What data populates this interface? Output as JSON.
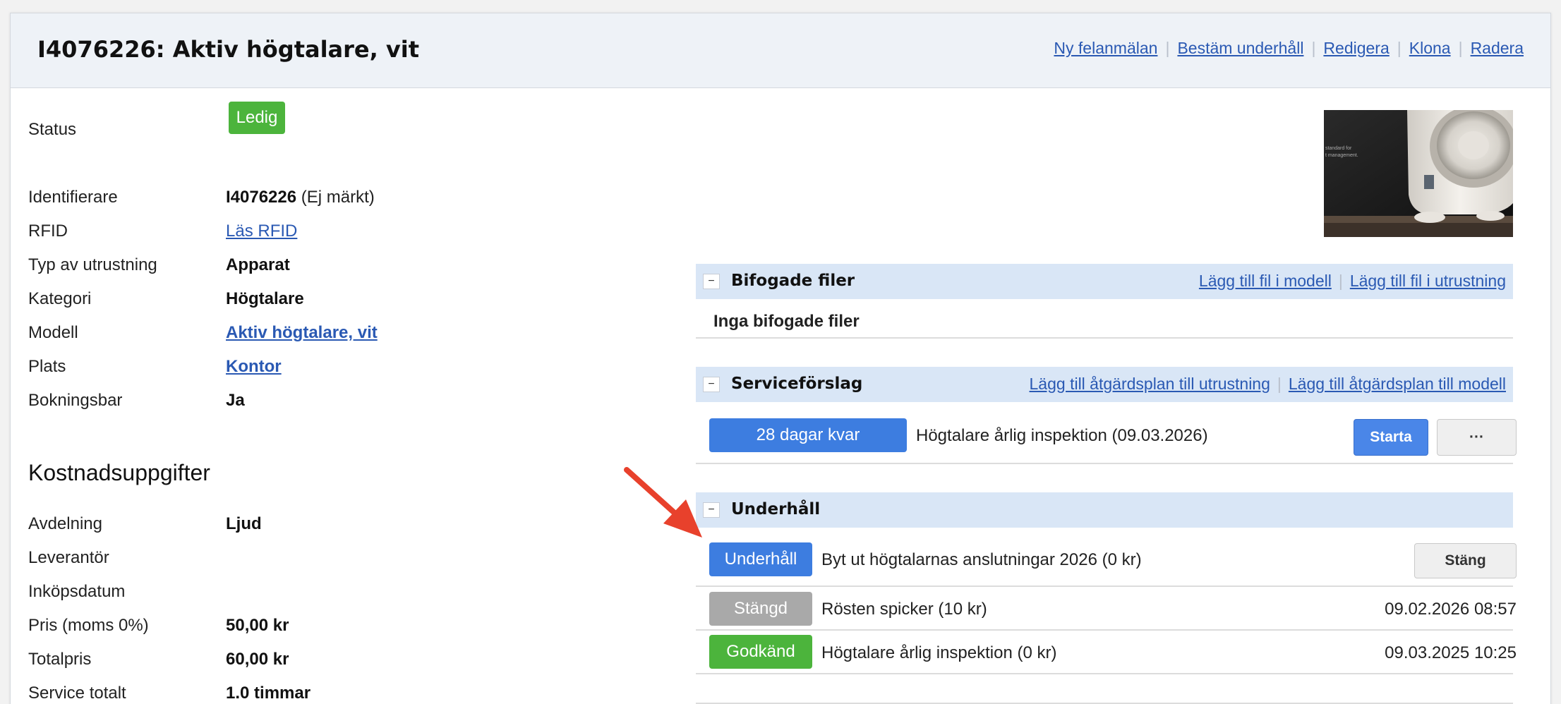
{
  "header": {
    "title": "I4076226: Aktiv högtalare, vit",
    "actions": [
      "Ny felanmälan",
      "Bestäm underhåll",
      "Redigera",
      "Klona",
      "Radera"
    ]
  },
  "status": {
    "label": "Status",
    "value": "Ledig",
    "color": "#4cb43c"
  },
  "details": {
    "identifier_label": "Identifierare",
    "identifier_value": "I4076226",
    "identifier_note": "(Ej märkt)",
    "rfid_label": "RFID",
    "rfid_link": "Läs RFID",
    "type_label": "Typ av utrustning",
    "type_value": "Apparat",
    "category_label": "Kategori",
    "category_value": "Högtalare",
    "model_label": "Modell",
    "model_link": "Aktiv högtalare, vit",
    "location_label": "Plats",
    "location_link": "Kontor",
    "bookable_label": "Bokningsbar",
    "bookable_value": "Ja"
  },
  "costs": {
    "heading": "Kostnadsuppgifter",
    "department_label": "Avdelning",
    "department_value": "Ljud",
    "supplier_label": "Leverantör",
    "purchase_date_label": "Inköpsdatum",
    "price_label": "Pris (moms 0%)",
    "price_value": "50,00 kr",
    "total_label": "Totalpris",
    "total_value": "60,00 kr",
    "service_label": "Service totalt",
    "service_value": "1.0 timmar"
  },
  "thumbnail": {
    "caption_line1": "standard for",
    "caption_line2": "t management."
  },
  "attachments": {
    "title": "Bifogade filer",
    "toggle": "−",
    "actions": [
      "Lägg till fil i modell",
      "Lägg till fil i utrustning"
    ],
    "empty": "Inga bifogade filer"
  },
  "service": {
    "title": "Serviceförslag",
    "toggle": "−",
    "actions": [
      "Lägg till åtgärdsplan till utrustning",
      "Lägg till åtgärdsplan till modell"
    ],
    "badge": "28 dagar kvar",
    "badge_color": "#3d7de0",
    "description": "Högtalare årlig inspektion (09.03.2026)",
    "start_button": "Starta",
    "more_button": "···"
  },
  "maintenance": {
    "title": "Underhåll",
    "toggle": "−",
    "items": [
      {
        "status": "Underhåll",
        "color": "#3d7de0",
        "text": "Byt ut högtalarnas anslutningar 2026 (0 kr)",
        "button": "Stäng"
      },
      {
        "status": "Stängd",
        "color": "#a9a9a9",
        "text": "Rösten spicker (10 kr)",
        "date": "09.02.2026 08:57"
      },
      {
        "status": "Godkänd",
        "color": "#4cb43c",
        "text": "Högtalare årlig inspektion (0 kr)",
        "date": "09.03.2025 10:25"
      }
    ]
  },
  "annotation": {
    "arrow_color": "#e8412c"
  }
}
